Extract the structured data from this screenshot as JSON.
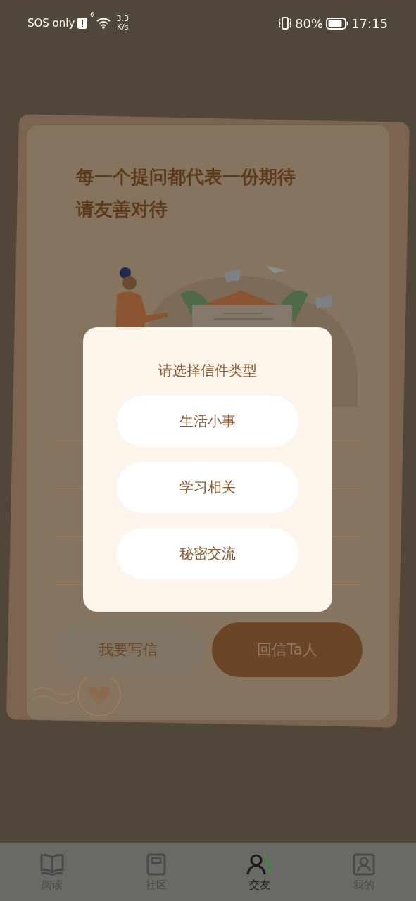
{
  "status_bar": {
    "carrier": "SOS only",
    "network": "6",
    "speed_value": "3.3",
    "speed_unit": "K/s",
    "battery": "80%",
    "time": "17:15"
  },
  "card": {
    "title_lines": [
      "每一个提问都代表一份期待",
      "请友善对待"
    ],
    "buttons": [
      {
        "label": "我要写信",
        "kind": "secondary"
      },
      {
        "label": "回信Ta人",
        "kind": "primary"
      }
    ]
  },
  "dialog": {
    "title": "请选择信件类型",
    "options": [
      "生活小事",
      "学习相关",
      "秘密交流"
    ]
  },
  "nav": [
    {
      "label": "阅读",
      "selected": false
    },
    {
      "label": "社区",
      "selected": false
    },
    {
      "label": "交友",
      "selected": true
    },
    {
      "label": "我的",
      "selected": false
    }
  ]
}
